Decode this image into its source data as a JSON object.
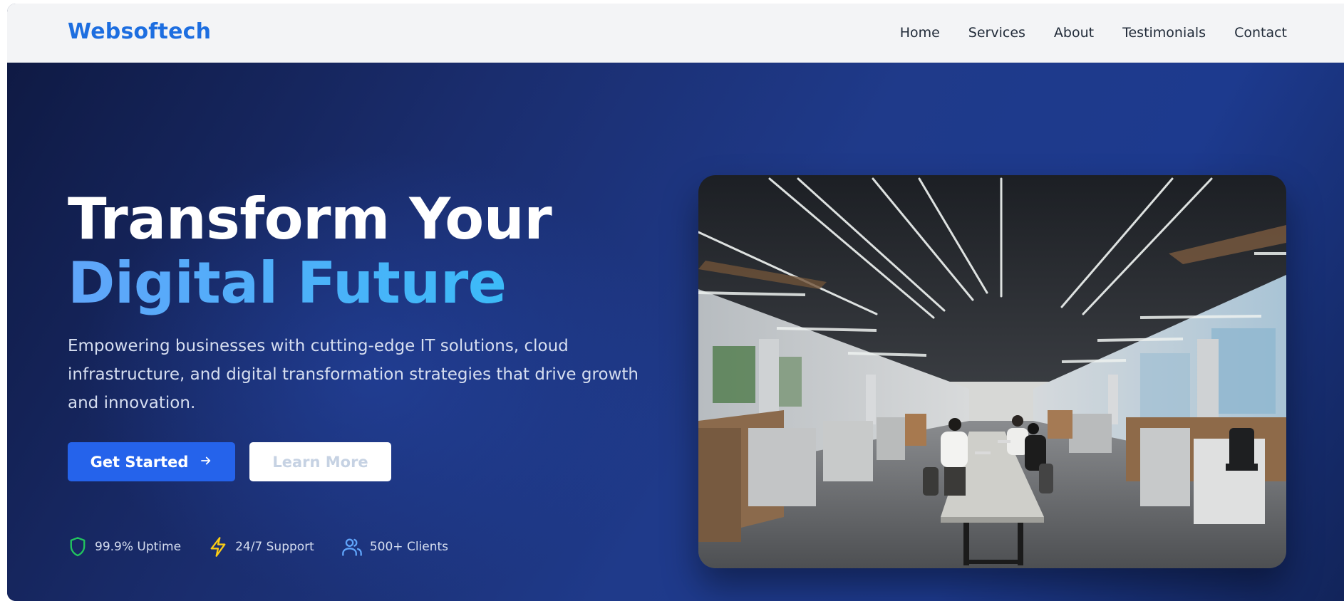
{
  "brand": {
    "name": "Websoftech",
    "color": "#1d6ee0"
  },
  "nav": {
    "items": [
      {
        "label": "Home"
      },
      {
        "label": "Services"
      },
      {
        "label": "About"
      },
      {
        "label": "Testimonials"
      },
      {
        "label": "Contact"
      }
    ]
  },
  "hero": {
    "headline_line1": "Transform Your",
    "headline_line2": "Digital Future",
    "subtitle": "Empowering businesses with cutting-edge IT solutions, cloud infrastructure, and digital transformation strategies that drive growth and innovation.",
    "primary_button": {
      "label": "Get Started",
      "icon": "arrow-right-icon"
    },
    "secondary_button": {
      "label": "Learn More"
    },
    "stats": [
      {
        "icon": "shield-icon",
        "label": "99.9% Uptime",
        "color": "#22c55e"
      },
      {
        "icon": "lightning-icon",
        "label": "24/7 Support",
        "color": "#facc15"
      },
      {
        "icon": "users-icon",
        "label": "500+ Clients",
        "color": "#60a5fa"
      }
    ],
    "image": {
      "subject": "open-plan-office-photo"
    }
  },
  "colors": {
    "accent": "#2563eb",
    "headline_gradient_start": "#60a5fa",
    "headline_gradient_end": "#38bdf8",
    "hero_background": "#1e3a8a",
    "navbar_background": "#f3f4f6"
  }
}
